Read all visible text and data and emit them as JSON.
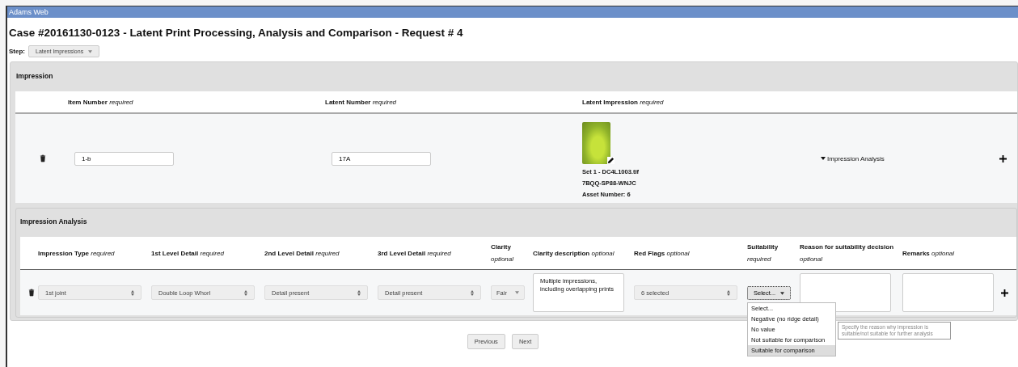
{
  "window": {
    "title": "Adams Web"
  },
  "page_title": "Case #20161130-0123 - Latent Print Processing, Analysis and Comparison - Request # 4",
  "step": {
    "label": "Step:",
    "value": "Latent Impressions"
  },
  "impression": {
    "title": "Impression",
    "columns": [
      {
        "name": "Item Number",
        "note": "required"
      },
      {
        "name": "Latent Number",
        "note": "required"
      },
      {
        "name": "Latent Impression",
        "note": "required"
      }
    ],
    "row": {
      "item_number": "1-b",
      "latent_number": "17A",
      "image_lines": [
        "Set 1  - DC4L1003.tif",
        "7BQQ-SP88-WNJC",
        "Asset Number: 6"
      ],
      "analysis_toggle": {
        "label": "Impression Analysis",
        "expanded": true
      }
    }
  },
  "analysis": {
    "title": "Impression Analysis",
    "columns": [
      {
        "name": "Impression Type",
        "note": "required"
      },
      {
        "name": "1st Level Detail",
        "note": "required"
      },
      {
        "name": "2nd Level Detail",
        "note": "required"
      },
      {
        "name": "3rd Level Detail",
        "note": "required"
      },
      {
        "name": "Clarity",
        "note": "optional"
      },
      {
        "name": "Clarity description",
        "note": "optional"
      },
      {
        "name": "Red Flags",
        "note": "optional"
      },
      {
        "name": "Suitability",
        "note": "required"
      },
      {
        "name": "Reason for suitability decision",
        "note": "optional"
      },
      {
        "name": "Remarks",
        "note": "optional"
      }
    ],
    "row": {
      "impression_type": "1st joint",
      "level1": "Double Loop Whorl",
      "level2": "Detail present",
      "level3": "Detail present",
      "clarity": "Fair",
      "clarity_description": "Multiple impressions, including overlapping prints",
      "red_flags": "6 selected",
      "suitability": "Select..."
    },
    "suitability_menu": [
      {
        "label": "Select...",
        "selected": false
      },
      {
        "label": "Negative (no ridge detail)",
        "selected": false
      },
      {
        "label": "No value",
        "selected": false
      },
      {
        "label": "Not suitable for comparison",
        "selected": false
      },
      {
        "label": "Suitable for comparison",
        "selected": true
      }
    ],
    "tooltip": "Specify the reason why impression is suitable/not suitable for further analysis"
  },
  "buttons": [
    "Previous",
    "Next"
  ]
}
